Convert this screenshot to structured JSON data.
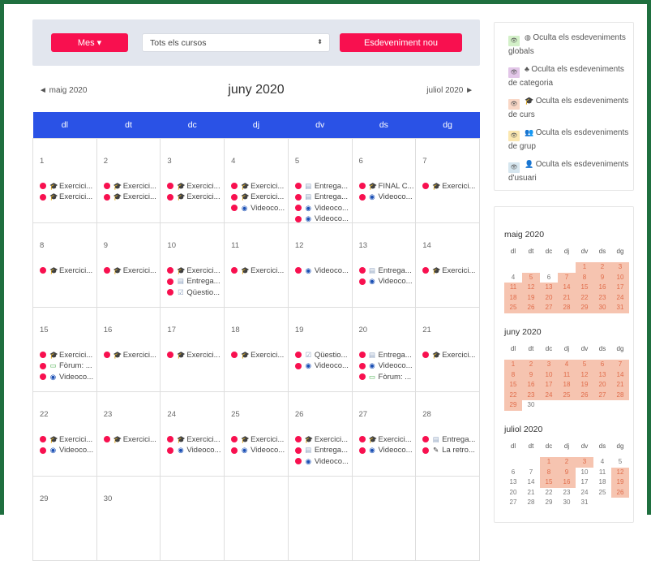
{
  "toolbar": {
    "view_label": "Mes ▾",
    "course_select": "Tots els cursos",
    "new_event_label": "Esdeveniment nou"
  },
  "nav": {
    "prev": "◄  maig 2020",
    "next": "juliol 2020  ►",
    "title": "juny 2020"
  },
  "weekdays": [
    "dl",
    "dt",
    "dc",
    "dj",
    "dv",
    "ds",
    "dg"
  ],
  "weeks": [
    [
      {
        "n": "1",
        "ev": [
          [
            "course",
            "Exercici..."
          ],
          [
            "course",
            "Exercici..."
          ]
        ]
      },
      {
        "n": "2",
        "ev": [
          [
            "course",
            "Exercici..."
          ],
          [
            "course",
            "Exercici..."
          ]
        ]
      },
      {
        "n": "3",
        "ev": [
          [
            "course",
            "Exercici..."
          ],
          [
            "course",
            "Exercici..."
          ]
        ]
      },
      {
        "n": "4",
        "ev": [
          [
            "course",
            "Exercici..."
          ],
          [
            "course",
            "Exercici..."
          ],
          [
            "video",
            "Videoco..."
          ]
        ]
      },
      {
        "n": "5",
        "ev": [
          [
            "assign",
            "Entrega..."
          ],
          [
            "assign",
            "Entrega..."
          ],
          [
            "video",
            "Videoco..."
          ],
          [
            "video",
            "Videoco..."
          ]
        ]
      },
      {
        "n": "6",
        "ev": [
          [
            "course",
            "FINAL C..."
          ],
          [
            "video",
            "Videoco..."
          ]
        ]
      },
      {
        "n": "7",
        "ev": [
          [
            "course",
            "Exercici..."
          ]
        ]
      }
    ],
    [
      {
        "n": "8",
        "ev": [
          [
            "course",
            "Exercici..."
          ]
        ]
      },
      {
        "n": "9",
        "ev": [
          [
            "course",
            "Exercici..."
          ]
        ]
      },
      {
        "n": "10",
        "ev": [
          [
            "course",
            "Exercici..."
          ],
          [
            "assign",
            "Entrega..."
          ],
          [
            "quiz",
            "Qüestio..."
          ]
        ]
      },
      {
        "n": "11",
        "ev": [
          [
            "course",
            "Exercici..."
          ]
        ]
      },
      {
        "n": "12",
        "ev": [
          [
            "video",
            "Videoco..."
          ]
        ]
      },
      {
        "n": "13",
        "ev": [
          [
            "assign",
            "Entrega..."
          ],
          [
            "video",
            "Videoco..."
          ]
        ]
      },
      {
        "n": "14",
        "ev": [
          [
            "course",
            "Exercici..."
          ]
        ]
      }
    ],
    [
      {
        "n": "15",
        "ev": [
          [
            "course",
            "Exercici..."
          ],
          [
            "forum",
            "Fòrum: ..."
          ],
          [
            "video",
            "Videoco..."
          ]
        ]
      },
      {
        "n": "16",
        "ev": [
          [
            "course",
            "Exercici..."
          ]
        ]
      },
      {
        "n": "17",
        "ev": [
          [
            "course",
            "Exercici..."
          ]
        ]
      },
      {
        "n": "18",
        "ev": [
          [
            "course",
            "Exercici..."
          ]
        ]
      },
      {
        "n": "19",
        "ev": [
          [
            "quiz",
            "Qüestio..."
          ],
          [
            "video",
            "Videoco..."
          ]
        ]
      },
      {
        "n": "20",
        "ev": [
          [
            "assign",
            "Entrega..."
          ],
          [
            "video",
            "Videoco..."
          ],
          [
            "forum",
            "Fòrum: ..."
          ]
        ]
      },
      {
        "n": "21",
        "ev": [
          [
            "course",
            "Exercici..."
          ]
        ]
      }
    ],
    [
      {
        "n": "22",
        "ev": [
          [
            "course",
            "Exercici..."
          ],
          [
            "video",
            "Videoco..."
          ]
        ]
      },
      {
        "n": "23",
        "ev": [
          [
            "course",
            "Exercici..."
          ]
        ]
      },
      {
        "n": "24",
        "ev": [
          [
            "course",
            "Exercici..."
          ],
          [
            "video",
            "Videoco..."
          ]
        ]
      },
      {
        "n": "25",
        "ev": [
          [
            "course",
            "Exercici..."
          ],
          [
            "video",
            "Videoco..."
          ]
        ]
      },
      {
        "n": "26",
        "ev": [
          [
            "course",
            "Exercici..."
          ],
          [
            "assign",
            "Entrega..."
          ],
          [
            "video",
            "Videoco..."
          ]
        ]
      },
      {
        "n": "27",
        "ev": [
          [
            "course",
            "Exercici..."
          ],
          [
            "video",
            "Videoco..."
          ]
        ]
      },
      {
        "n": "28",
        "ev": [
          [
            "assign",
            "Entrega..."
          ],
          [
            "retro",
            "La retro..."
          ]
        ]
      }
    ],
    [
      {
        "n": "29",
        "ev": []
      },
      {
        "n": "30",
        "ev": []
      },
      {
        "n": "",
        "ev": []
      },
      {
        "n": "",
        "ev": []
      },
      {
        "n": "",
        "ev": []
      },
      {
        "n": "",
        "ev": []
      },
      {
        "n": "",
        "ev": []
      }
    ]
  ],
  "legend": [
    {
      "color": "#d3f0c8",
      "icon": "globe-icon",
      "glyph": "◍",
      "text": "Oculta els esdeveniments globals"
    },
    {
      "color": "#e2c6e8",
      "icon": "category-icon",
      "glyph": "♣",
      "text": "Oculta els esdeveniments de categoria"
    },
    {
      "color": "#f9d7c6",
      "icon": "course-icon",
      "glyph": "🎓",
      "text": "Oculta els esdeveniments de curs"
    },
    {
      "color": "#fbe7b0",
      "icon": "group-icon",
      "glyph": "👥",
      "text": "Oculta els esdeveniments de grup"
    },
    {
      "color": "#d6e6ef",
      "icon": "user-icon",
      "glyph": "👤",
      "text": "Oculta els esdeveniments d'usuari"
    }
  ],
  "mini": [
    {
      "title": "maig 2020",
      "offset": 4,
      "days": 31,
      "ev": [
        1,
        2,
        3,
        5,
        7,
        8,
        9,
        10,
        11,
        12,
        13,
        14,
        15,
        16,
        17,
        18,
        19,
        20,
        21,
        22,
        23,
        24,
        25,
        26,
        27,
        28,
        29,
        30,
        31
      ]
    },
    {
      "title": "juny 2020",
      "offset": 0,
      "days": 30,
      "ev": [
        1,
        2,
        3,
        4,
        5,
        6,
        7,
        8,
        9,
        10,
        11,
        12,
        13,
        14,
        15,
        16,
        17,
        18,
        19,
        20,
        21,
        22,
        23,
        24,
        25,
        26,
        27,
        28,
        29
      ]
    },
    {
      "title": "juliol 2020",
      "offset": 2,
      "days": 31,
      "ev": [
        1,
        2,
        3,
        8,
        9,
        12,
        15,
        16,
        19,
        26
      ]
    }
  ],
  "colors": {
    "accent": "#f8104f",
    "header": "#2a52e6",
    "mini_event": "#f6c4b0"
  }
}
